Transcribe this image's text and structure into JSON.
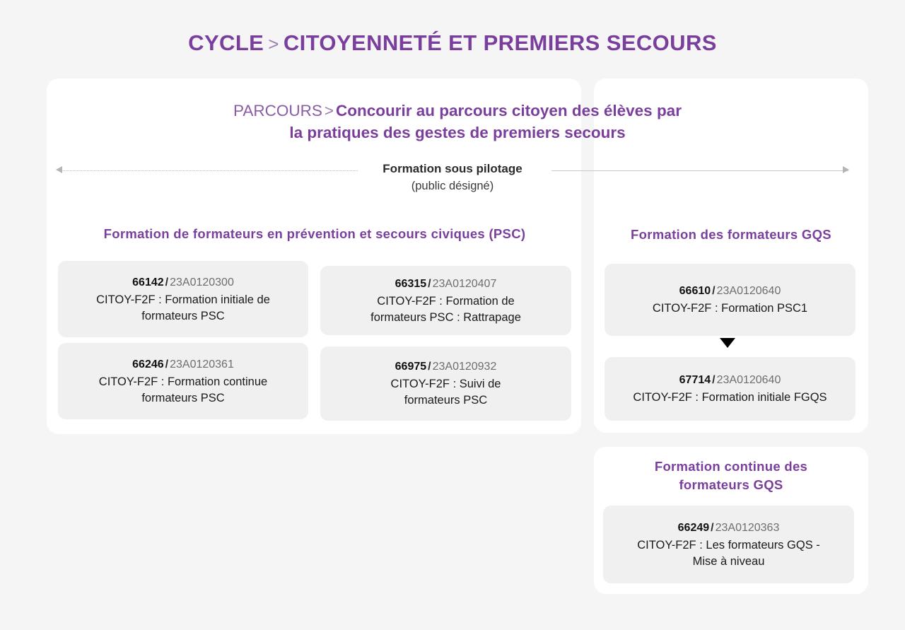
{
  "header": {
    "cycle_label": "CYCLE",
    "chevron": ">",
    "cycle_name": "CITOYENNETÉ ET PREMIERS SECOURS"
  },
  "parcours": {
    "label": "PARCOURS",
    "chevron": ">",
    "name_line1": "Concourir au parcours citoyen des élèves par",
    "name_line2": "la pratiques des gestes de premiers secours"
  },
  "axis": {
    "title": "Formation sous pilotage",
    "subtitle": "(public désigné)",
    "left_arrow_icon": "arrow-left-icon",
    "right_arrow_icon": "arrow-right-icon"
  },
  "sections": {
    "psc": {
      "heading": "Formation de formateurs en prévention et secours civiques (PSC)"
    },
    "gqs": {
      "heading": "Formation des formateurs GQS",
      "flow_arrow_icon": "arrow-down-icon"
    },
    "gqs_continue": {
      "heading_line1": "Formation continue des",
      "heading_line2": "formateurs GQS"
    }
  },
  "cards": {
    "c66142": {
      "code": "66142",
      "separator": "/",
      "session": "23A0120300",
      "desc_line1": "CITOY-F2F : Formation initiale de",
      "desc_line2": "formateurs PSC"
    },
    "c66246": {
      "code": "66246",
      "separator": "/",
      "session": "23A0120361",
      "desc_line1": "CITOY-F2F : Formation continue",
      "desc_line2": "formateurs PSC"
    },
    "c66315": {
      "code": "66315",
      "separator": "/",
      "session": "23A0120407",
      "desc_line1": "CITOY-F2F : Formation de",
      "desc_line2": "formateurs PSC : Rattrapage"
    },
    "c66975": {
      "code": "66975",
      "separator": "/",
      "session": "23A0120932",
      "desc_line1": "CITOY-F2F : Suivi de",
      "desc_line2": "formateurs PSC"
    },
    "c66610": {
      "code": "66610",
      "separator": "/",
      "session": "23A0120640",
      "desc_line1": "CITOY-F2F : Formation PSC1",
      "desc_line2": ""
    },
    "c67714": {
      "code": "67714",
      "separator": "/",
      "session": "23A0120640",
      "desc_line1": "CITOY-F2F : Formation initiale FGQS",
      "desc_line2": ""
    },
    "c66249": {
      "code": "66249",
      "separator": "/",
      "session": "23A0120363",
      "desc_line1": "CITOY-F2F : Les formateurs GQS -",
      "desc_line2": "Mise à niveau"
    }
  },
  "colors": {
    "brand_purple": "#7a3f9d",
    "page_background": "#f5f5f6",
    "panel_background": "#ffffff",
    "card_background": "#f0f0f0",
    "session_text": "#6e6e6e"
  }
}
